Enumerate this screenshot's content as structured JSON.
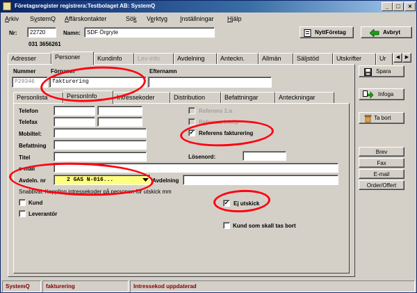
{
  "window": {
    "title": "Företagsregister registrera:Testbolaget AB: SystemQ",
    "controls": [
      "_",
      "□",
      "×"
    ]
  },
  "menubar": {
    "items": [
      {
        "label": "Arkiv",
        "u": "A"
      },
      {
        "label": "SystemQ",
        "u": "y"
      },
      {
        "label": "Affärskontakter",
        "u": "A"
      },
      {
        "label": "Sök",
        "u": "k"
      },
      {
        "label": "Verktyg",
        "u": "e"
      },
      {
        "label": "Inställningar",
        "u": "I"
      },
      {
        "label": "Hjälp",
        "u": "H"
      }
    ]
  },
  "header": {
    "nr_label": "Nr:",
    "nr_value": "22720",
    "namn_label": "Namn:",
    "namn_value": "SDF Örgryte",
    "phone": "031 3656261",
    "new_company_button": "NyttFöretag",
    "cancel_button": "Avbryt"
  },
  "main_tabs": [
    "Adresser",
    "Personer",
    "Kundinfo",
    "Lev-info",
    "Avdelning",
    "Anteckn.",
    "Allmän",
    "Säljstöd",
    "Utskrifter",
    "Ur"
  ],
  "main_tabs_active": "Personer",
  "main_tabs_disabled": [
    "Lev-info"
  ],
  "person": {
    "nummer_label": "Nummer",
    "fornamn_label": "Förnamn",
    "efternamn_label": "Efternamn",
    "nummer_value": "P29346",
    "fornamn_value": "fakturering",
    "efternamn_value": ""
  },
  "sub_tabs": [
    "Personlista",
    "PersonInfo",
    "Intressekoder",
    "Distribution",
    "Befattningar",
    "Anteckningar"
  ],
  "sub_tabs_active": "PersonInfo",
  "form": {
    "telefon_label": "Telefon",
    "telefax_label": "Telefax",
    "mobiltel_label": "Mobiltel:",
    "befattning_label": "Befattning",
    "titel_label": "Titel",
    "email_label": "e-mail",
    "avdeln_label": "Avdeln. nr",
    "avdeln_value": "2    GAS N-016...",
    "avdelning_label": "Avdelning",
    "losenord_label": "Lösenord:",
    "referens1_label": "Referens 1:a",
    "referens_inkop_label": "Referens inköp",
    "referens_fakt_label": "Referens fakturering",
    "selection_text": "Snabbval: Koppling intressekoder på personen för utskick mm",
    "kund_label": "Kund",
    "leverantor_label": "Leverantör",
    "ej_utskick_label": "Ej utskick",
    "kund_bort_label": "Kund som skall tas bort"
  },
  "checks": {
    "referens1": false,
    "referens_inkop": false,
    "referens_fakt": true,
    "kund": false,
    "leverantor": false,
    "ej_utskick": true,
    "kund_bort": false
  },
  "side_buttons": {
    "spara": "Spara",
    "infoga": "Infoga",
    "ta_bort": "Ta bort",
    "brev": "Brev",
    "fax": "Fax",
    "email": "E-mail",
    "order": "Order/Offert"
  },
  "status": {
    "app": "SystemQ",
    "user": "fakturering",
    "message": "Intressekod uppdaterad"
  },
  "colors": {
    "annotation": "#ff0010",
    "title_bar": "#0a246a",
    "status_text": "#800000"
  }
}
